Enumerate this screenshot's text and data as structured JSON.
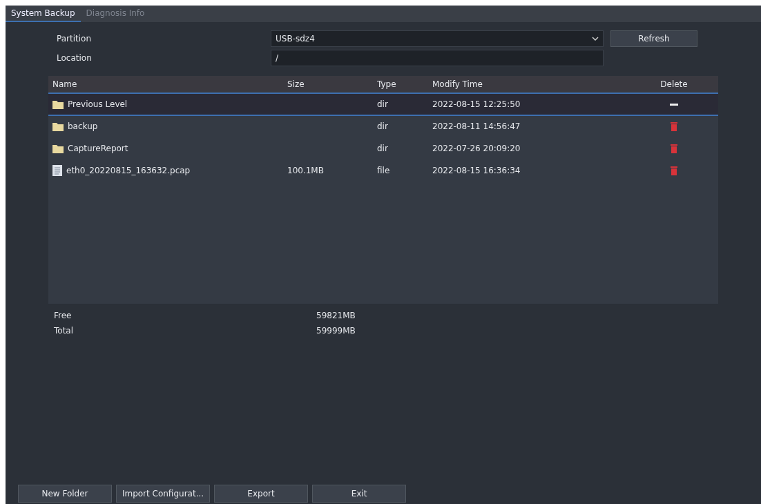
{
  "tabs": [
    {
      "label": "System Backup",
      "selected": true
    },
    {
      "label": "Diagnosis Info",
      "selected": false
    }
  ],
  "partition": {
    "label": "Partition",
    "value": "USB-sdz4"
  },
  "refresh_button": "Refresh",
  "location": {
    "label": "Location",
    "value": "/"
  },
  "table": {
    "columns": [
      "Name",
      "Size",
      "Type",
      "Modify Time",
      "Delete"
    ],
    "rows": [
      {
        "kind": "folder",
        "name": "Previous Level",
        "size": "",
        "type": "dir",
        "time": "2022-08-15 12:25:50",
        "deletable": false,
        "selected": true
      },
      {
        "kind": "folder",
        "name": "backup",
        "size": "",
        "type": "dir",
        "time": "2022-08-11 14:56:47",
        "deletable": true,
        "selected": false
      },
      {
        "kind": "folder",
        "name": "CaptureReport",
        "size": "",
        "type": "dir",
        "time": "2022-07-26 20:09:20",
        "deletable": true,
        "selected": false
      },
      {
        "kind": "file",
        "name": "eth0_20220815_163632.pcap",
        "size": "100.1MB",
        "type": "file",
        "time": "2022-08-15 16:36:34",
        "deletable": true,
        "selected": false
      }
    ]
  },
  "stats": [
    {
      "label": "Free",
      "value": "59821MB"
    },
    {
      "label": "Total",
      "value": "59999MB"
    }
  ],
  "buttons": [
    "New Folder",
    "Import Configurat...",
    "Export",
    "Exit"
  ]
}
